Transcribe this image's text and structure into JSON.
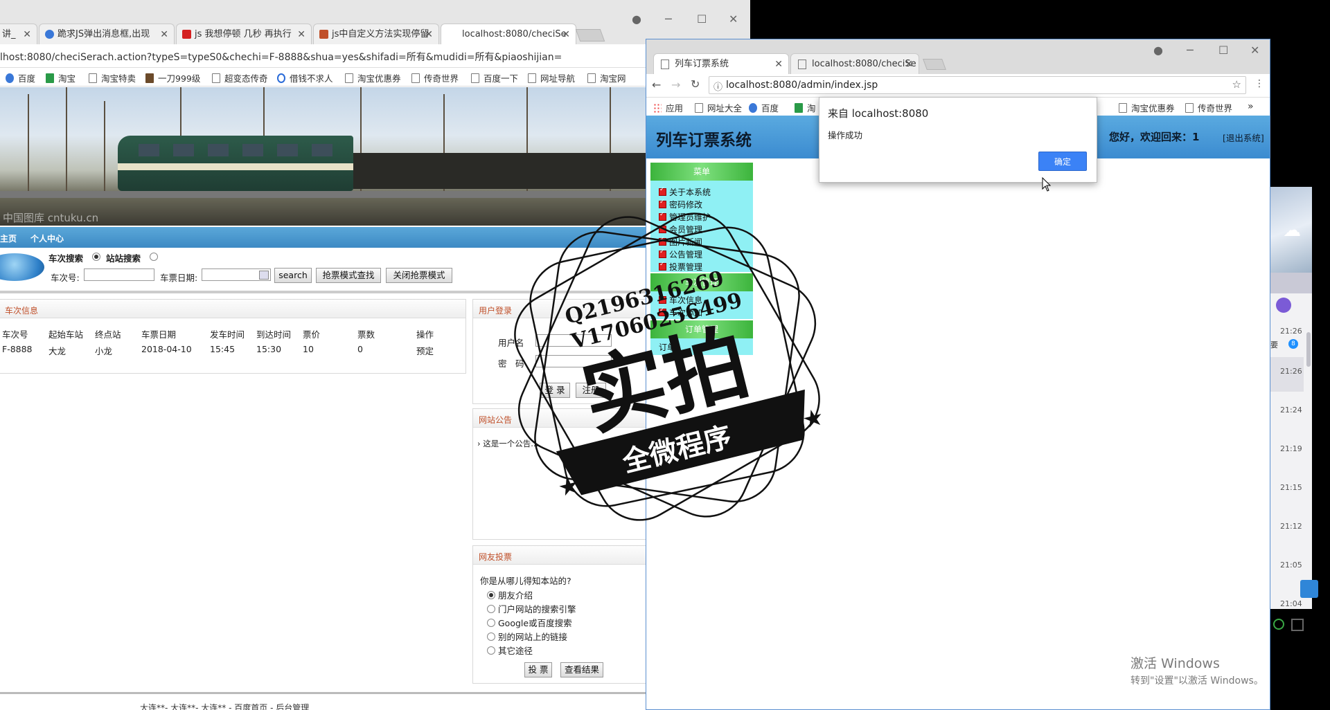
{
  "back_browser": {
    "tabs": [
      {
        "label": "讲_"
      },
      {
        "label": "跪求JS弹出消息框,出现"
      },
      {
        "label": "js 我想停顿 几秒 再执行"
      },
      {
        "label": "js中自定义方法实现停留"
      },
      {
        "label": "localhost:8080/checiSe"
      }
    ],
    "url": "lhost:8080/checiSerach.action?typeS=typeS0&chechi=F-8888&shua=yes&shifadi=所有&mudidi=所有&piaoshijian=",
    "bookmarks": [
      "百度",
      "淘宝",
      "淘宝特卖",
      "一刀999级",
      "超变态传奇",
      "借钱不求人",
      "淘宝优惠券",
      "传奇世界",
      "百度一下",
      "网址导航",
      "淘宝网"
    ],
    "banner_watermark": "中国图库 cntuku.cn",
    "nav": [
      "主页",
      "个人中心"
    ],
    "search": {
      "mode_train": "车次搜索",
      "mode_station": "站站搜索",
      "train_no_label": "车次号:",
      "date_label": "车票日期:",
      "search_button": "search",
      "grab_find_button": "抢票模式查找",
      "close_grab_button": "关闭抢票模式"
    },
    "train_panel": {
      "title": "车次信息",
      "columns": [
        "车次号",
        "起始车站",
        "终点站",
        "车票日期",
        "发车时间",
        "到达时间",
        "票价",
        "票数",
        "操作"
      ],
      "rows": [
        [
          "F-8888",
          "大龙",
          "小龙",
          "2018-04-10",
          "15:45",
          "15:30",
          "10",
          "0",
          "预定"
        ]
      ]
    },
    "login_panel": {
      "title": "用户登录",
      "username_label": "用户名",
      "password_label": "密　码",
      "login_button": "登 录",
      "register_button": "注册"
    },
    "notice_panel": {
      "title": "网站公告",
      "item": "这是一个公告..."
    },
    "vote_panel": {
      "title": "网友投票",
      "question": "你是从哪儿得知本站的?",
      "options": [
        "朋友介绍",
        "门户网站的搜索引擎",
        "Google或百度搜索",
        "别的网站上的链接",
        "其它途径"
      ],
      "vote_button": "投 票",
      "result_button": "查看结果"
    },
    "footer": "大连**- 大连**- 大连** - 百度首页 - 后台管理"
  },
  "front_browser": {
    "tabs": [
      {
        "label": "列车订票系统"
      },
      {
        "label": "localhost:8080/checiSe"
      }
    ],
    "url": "localhost:8080/admin/index.jsp",
    "bookmarks": [
      "应用",
      "网址大全",
      "百度",
      "淘",
      "淘宝优惠券",
      "传奇世界"
    ],
    "system_title": "列车订票系统",
    "welcome": "您好，欢迎回来：1",
    "logout": "[退出系统]",
    "menu": {
      "head1": "菜单",
      "items1": [
        "关于本系统",
        "密码修改",
        "管理员维护",
        "会员管理",
        "图片新闻",
        "公告管理",
        "投票管理"
      ],
      "head2": "车次管理",
      "items2": [
        "车次信息",
        "车次添加"
      ],
      "head3": "订单管理",
      "items3": [
        "订单"
      ]
    }
  },
  "dialog": {
    "title": "来自 localhost:8080",
    "message": "操作成功",
    "ok_button": "确定"
  },
  "chat_strip": {
    "times": [
      "21:26",
      "21:26",
      "21:24",
      "21:19",
      "21:15",
      "21:12",
      "21:05",
      "21:04"
    ],
    "snippet": "要",
    "badge": "8"
  },
  "windows_activation": {
    "line1": "激活 Windows",
    "line2": "转到\"设置\"以激活 Windows。"
  },
  "stamp": {
    "qq": "Q2196316269",
    "vx": "V17060256499",
    "big": "实拍",
    "ribbon": "全微程序"
  }
}
